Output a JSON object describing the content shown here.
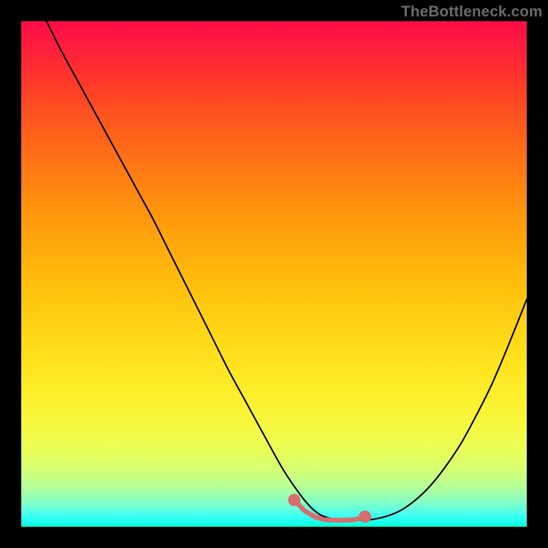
{
  "watermark": "TheBottleneck.com",
  "chart_data": {
    "type": "line",
    "title": "",
    "xlabel": "",
    "ylabel": "",
    "xlim": [
      0,
      100
    ],
    "ylim": [
      0,
      100
    ],
    "grid": false,
    "series": [
      {
        "name": "bottleneck-curve",
        "color": "#000000",
        "x": [
          5,
          8,
          11,
          14,
          17,
          20,
          23,
          26,
          29,
          32,
          35,
          38,
          41,
          44,
          47,
          50,
          52,
          54,
          56,
          58,
          60,
          63,
          66,
          69,
          72,
          75,
          78,
          81,
          84,
          87,
          90,
          93,
          96,
          100
        ],
        "y": [
          100,
          94,
          88.5,
          83,
          77.5,
          72,
          66.5,
          61,
          55,
          49,
          43,
          37,
          31,
          25.5,
          20,
          14.5,
          11,
          8,
          5.3,
          3.2,
          2.0,
          1.4,
          1.3,
          1.4,
          2.0,
          3.2,
          5.3,
          8.2,
          12,
          16.5,
          22,
          28,
          35,
          45
        ]
      }
    ],
    "markers": {
      "name": "sweet-spot",
      "color": "#d96d6d",
      "radius": 9,
      "stroke_width": 7,
      "points": [
        {
          "x": 54,
          "y": 5.3
        },
        {
          "x": 56,
          "y": 3.2
        },
        {
          "x": 58,
          "y": 2.0
        },
        {
          "x": 60,
          "y": 1.4
        },
        {
          "x": 62,
          "y": 1.3
        },
        {
          "x": 64,
          "y": 1.3
        },
        {
          "x": 66,
          "y": 1.4
        },
        {
          "x": 68,
          "y": 2.0
        }
      ]
    },
    "background_gradient": {
      "top": "#ff0b48",
      "mid": "#ffd313",
      "bottom": "#00ffc2"
    }
  }
}
